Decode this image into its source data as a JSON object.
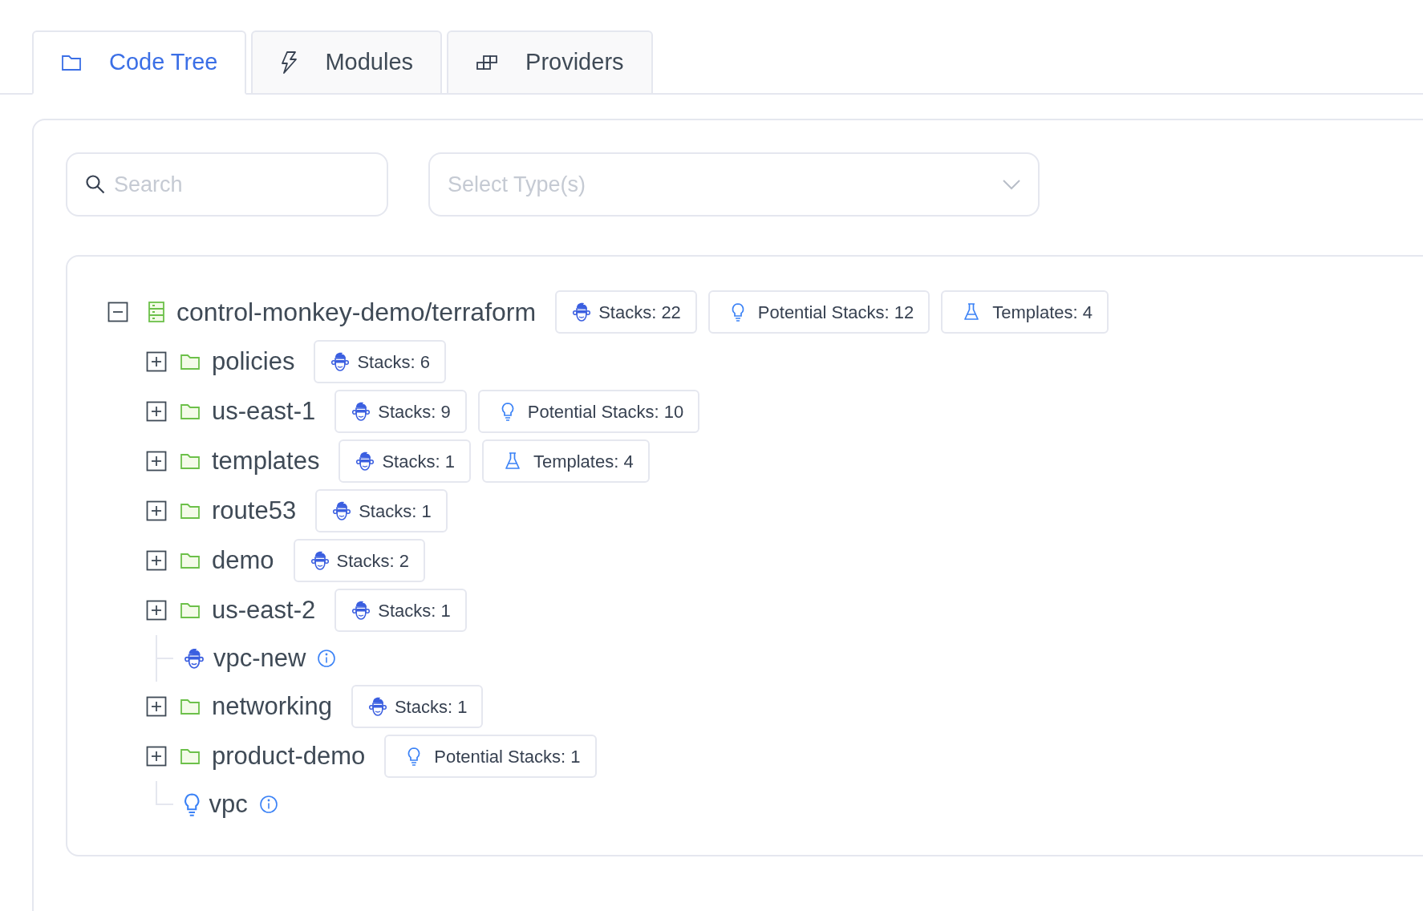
{
  "tabs": [
    {
      "label": "Code Tree",
      "kind": "folder",
      "selected": true
    },
    {
      "label": "Modules",
      "kind": "bolt",
      "selected": false
    },
    {
      "label": "Providers",
      "kind": "blocks",
      "selected": false
    }
  ],
  "search": {
    "placeholder": "Search"
  },
  "type_select": {
    "placeholder": "Select Type(s)"
  },
  "tree": {
    "label": "control-monkey-demo/terraform",
    "expanded": true,
    "badges": [
      {
        "kind": "stacks",
        "label": "Stacks: 22"
      },
      {
        "kind": "potential",
        "label": "Potential Stacks: 12"
      },
      {
        "kind": "templates",
        "label": "Templates: 4"
      }
    ],
    "children": [
      {
        "label": "policies",
        "kind": "folder",
        "expanded": false,
        "badges": [
          {
            "kind": "stacks",
            "label": "Stacks: 6"
          }
        ]
      },
      {
        "label": "us-east-1",
        "kind": "folder",
        "expanded": false,
        "badges": [
          {
            "kind": "stacks",
            "label": "Stacks: 9"
          },
          {
            "kind": "potential",
            "label": "Potential Stacks: 10"
          }
        ]
      },
      {
        "label": "templates",
        "kind": "folder",
        "expanded": false,
        "badges": [
          {
            "kind": "stacks",
            "label": "Stacks: 1"
          },
          {
            "kind": "templates",
            "label": "Templates: 4"
          }
        ]
      },
      {
        "label": "route53",
        "kind": "folder",
        "expanded": false,
        "badges": [
          {
            "kind": "stacks",
            "label": "Stacks: 1"
          }
        ]
      },
      {
        "label": "demo",
        "kind": "folder",
        "expanded": false,
        "badges": [
          {
            "kind": "stacks",
            "label": "Stacks: 2"
          }
        ]
      },
      {
        "label": "us-east-2",
        "kind": "folder",
        "expanded": false,
        "badges": [
          {
            "kind": "stacks",
            "label": "Stacks: 1"
          }
        ]
      },
      {
        "label": "vpc-new",
        "kind": "stack"
      },
      {
        "label": "networking",
        "kind": "folder",
        "expanded": false,
        "badges": [
          {
            "kind": "stacks",
            "label": "Stacks: 1"
          }
        ]
      },
      {
        "label": "product-demo",
        "kind": "folder",
        "expanded": false,
        "badges": [
          {
            "kind": "potential",
            "label": "Potential Stacks: 1"
          }
        ]
      },
      {
        "label": "vpc",
        "kind": "potential"
      }
    ]
  }
}
